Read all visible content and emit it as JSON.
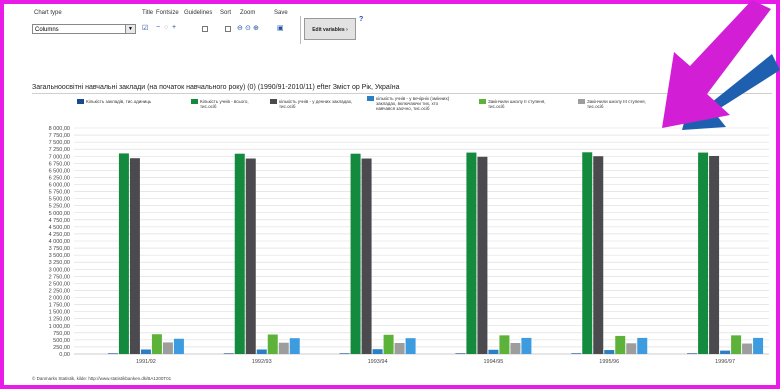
{
  "toolbar": {
    "chart_type_label": "Chart type",
    "chart_type_value": "Columns",
    "title_label": "Title",
    "fontsize_label": "Fontsize",
    "guidelines_label": "Guidelines",
    "sort_label": "Sort",
    "zoom_label": "Zoom",
    "save_label": "Save",
    "edit_variables_label": "Edit variables",
    "help_label": "?"
  },
  "arrows": {
    "left_color": "#d21fd6",
    "right_color": "#1f5fb0"
  },
  "chart_data": {
    "type": "bar",
    "title": "Загальноосвітні навчальні заклади (на початок навчального року) (0) (1990/91-2010/11) efter Зміст ор Рік, Україна",
    "categories": [
      "1991/92",
      "1992/93",
      "1993/94",
      "1994/95",
      "1995/96",
      "1996/97"
    ],
    "ylim": [
      0,
      8000
    ],
    "yticks": [
      "0,00",
      "250,00",
      "500,00",
      "750,00",
      "1 000,00",
      "1 250,00",
      "1 500,00",
      "1 750,00",
      "2 000,00",
      "2 250,00",
      "2 500,00",
      "2 750,00",
      "3 000,00",
      "3 250,00",
      "3 500,00",
      "3 750,00",
      "4 000,00",
      "4 250,00",
      "4 500,00",
      "4 750,00",
      "5 000,00",
      "5 250,00",
      "5 500,00",
      "5 750,00",
      "6 000,00",
      "6 250,00",
      "6 500,00",
      "6 750,00",
      "7 000,00",
      "7 250,00",
      "7 500,00",
      "7 750,00",
      "8 000,00"
    ],
    "legend_position": "top",
    "grid": true,
    "series": [
      {
        "name": "Кількість закладів, тис.одиниць",
        "color": "#1a4a8c",
        "values": [
          21,
          21,
          22,
          22,
          22,
          22
        ]
      },
      {
        "name": "Кількість учнів - всього, тис.осіб",
        "color": "#138a3d",
        "values": [
          7100,
          7090,
          7090,
          7130,
          7140,
          7130
        ]
      },
      {
        "name": "кількість учнів - у денних закладах, тис.осіб",
        "color": "#4a4a4f",
        "values": [
          6930,
          6920,
          6920,
          6980,
          7000,
          7010
        ]
      },
      {
        "name": "кількість учнів - у вечірніх (змінних) закладах, включаючи тих, хто навчався заочно, тис.осіб",
        "color": "#2b7fc4",
        "values": [
          160,
          160,
          170,
          150,
          140,
          120
        ]
      },
      {
        "name": "Закінчили школу ІІ ступеня, тис.осіб",
        "color": "#5db33a",
        "values": [
          700,
          690,
          680,
          660,
          640,
          660
        ]
      },
      {
        "name": "Закінчили школу ІІІ ступеня, тис.осіб",
        "color": "#9d9d9d",
        "values": [
          410,
          400,
          390,
          390,
          380,
          370
        ]
      },
      {
        "name": "",
        "color": "#3d9be0",
        "values": [
          540,
          560,
          560,
          570,
          570,
          570
        ]
      }
    ]
  },
  "footer": "© Danmarks Statistik, kilde: http://www.statistikbanken.dk/BA1200T01"
}
